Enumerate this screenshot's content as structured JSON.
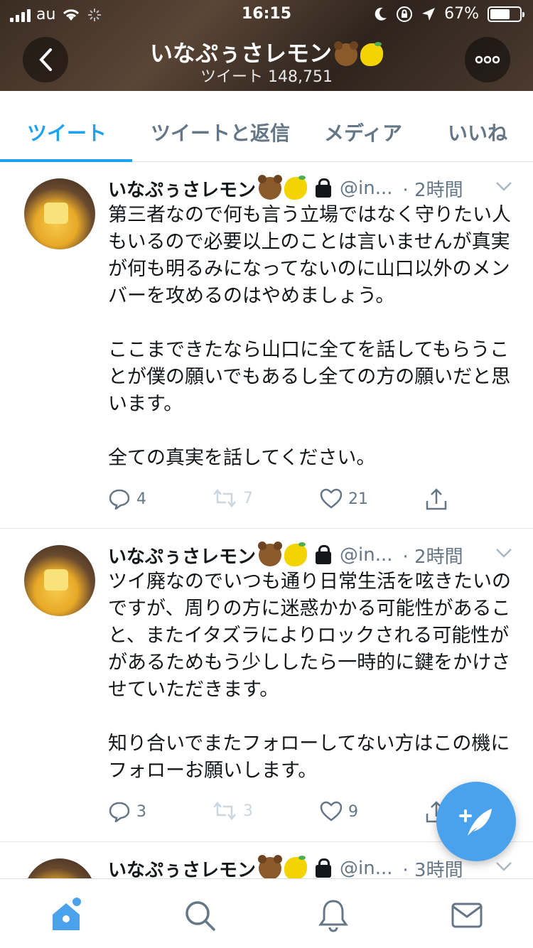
{
  "status_bar": {
    "carrier": "au",
    "time": "16:15",
    "battery": "67%"
  },
  "header": {
    "title": "いなぷぅさレモン",
    "subtitle": "ツイート 148,751"
  },
  "tabs": [
    {
      "label": "ツイート",
      "active": true
    },
    {
      "label": "ツイートと返信",
      "active": false
    },
    {
      "label": "メディア",
      "active": false
    },
    {
      "label": "いいね",
      "active": false
    }
  ],
  "tweets": [
    {
      "name": "いなぷぅさレモン",
      "handle": "@in...",
      "time": "· 2時間",
      "text": "第三者なので何も言う立場ではなく守りたい人もいるので必要以上のことは言いませんが真実が何も明るみになってないのに山口以外のメンバーを攻めるのはやめましょう。\n\nここまできたなら山口に全てを話してもらうことが僕の願いでもあるし全ての方の願いだと思います。\n\n全ての真実を話してください。",
      "replies": "4",
      "retweets": "7",
      "likes": "21"
    },
    {
      "name": "いなぷぅさレモン",
      "handle": "@in...",
      "time": "· 2時間",
      "text": "ツイ廃なのでいつも通り日常生活を呟きたいのですが、周りの方に迷惑かかる可能性があること、またイタズラによりロックされる可能性ががあるためもう少ししたら一時的に鍵をかけさせていただきます。\n\n知り合いでまたフォローしてない方はこの機にフォローお願いします。",
      "replies": "3",
      "retweets": "3",
      "likes": "9"
    },
    {
      "name": "いなぷぅさレモン",
      "handle": "@in...",
      "time": "· 3時間"
    }
  ],
  "colors": {
    "accent": "#1da1f2",
    "fab": "#4aa1ec",
    "muted": "#657786"
  }
}
